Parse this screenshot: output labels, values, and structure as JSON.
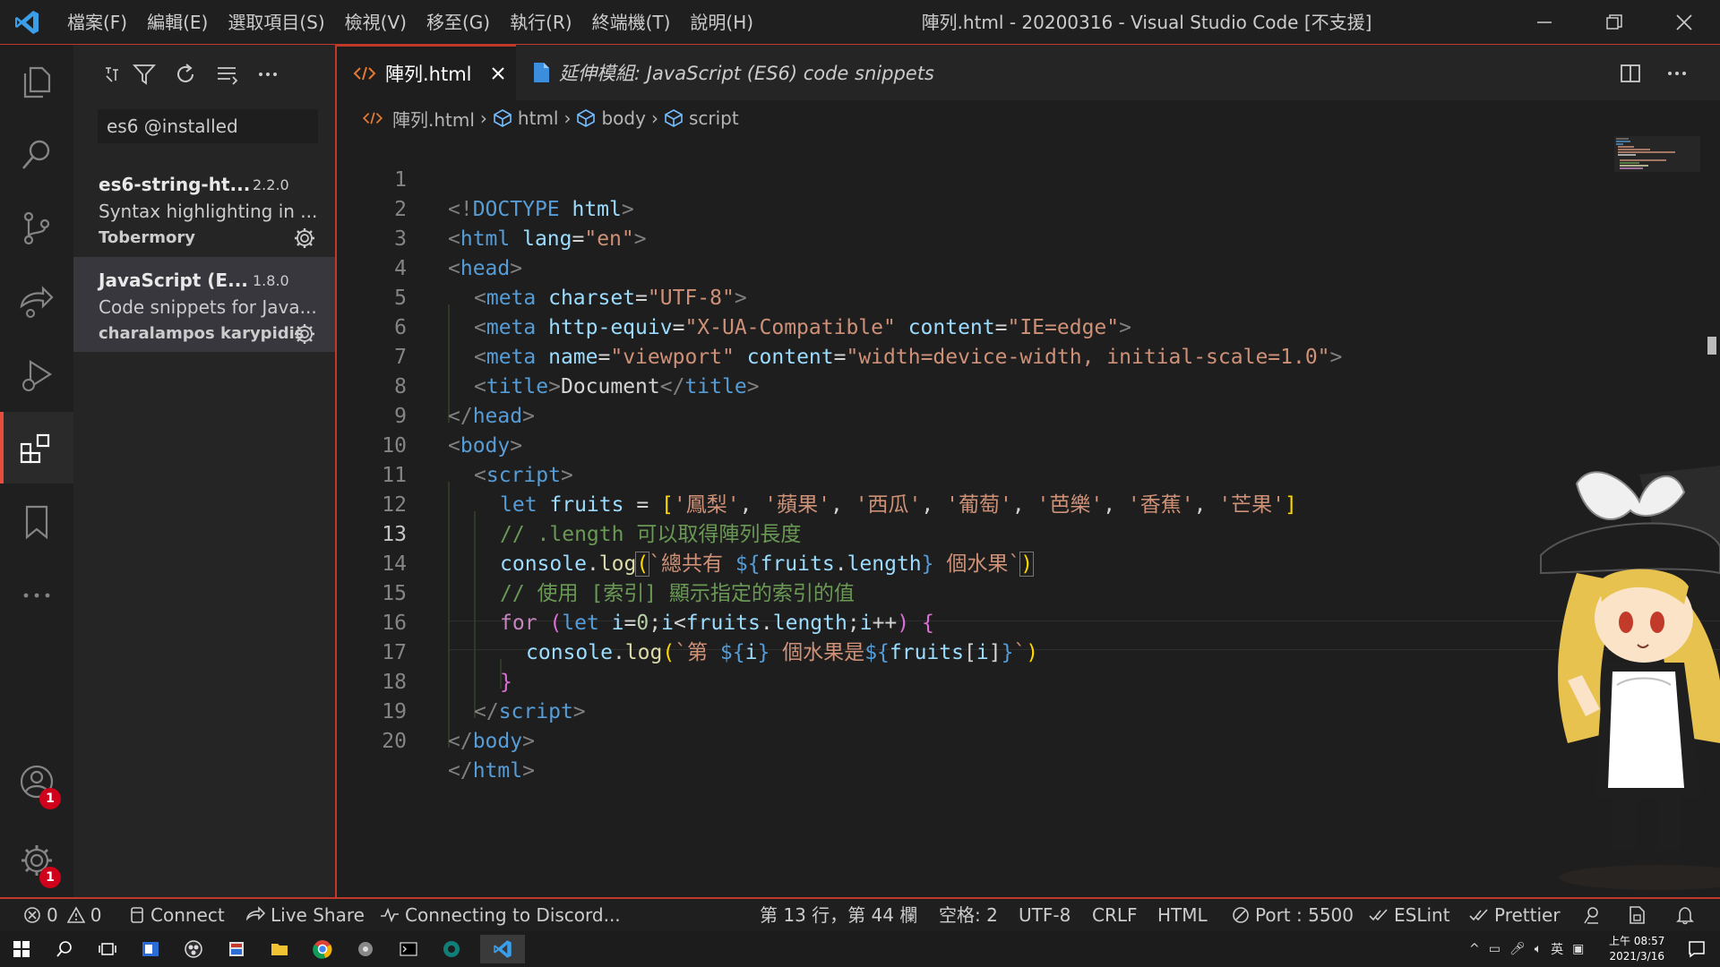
{
  "titlebar": {
    "menu": [
      "檔案(F)",
      "編輯(E)",
      "選取項目(S)",
      "檢視(V)",
      "移至(G)",
      "執行(R)",
      "終端機(T)",
      "說明(H)"
    ],
    "window_title": "陣列.html - 20200316 - Visual Studio Code [不支援]"
  },
  "activitybar": {
    "items": [
      "files-icon",
      "search-icon",
      "source-control-icon",
      "live-share-icon",
      "run-debug-icon",
      "extensions-icon",
      "bookmarks-icon",
      "more-icon"
    ],
    "accounts_badge": "1",
    "settings_badge": "1"
  },
  "sidebar": {
    "toolbar_icons": [
      "clear-icon",
      "filter-icon",
      "refresh-icon",
      "collapse-icon",
      "more-icon"
    ],
    "search_value": "es6 @installed",
    "extensions": [
      {
        "name": "es6-string-ht...",
        "version": "2.2.0",
        "description": "Syntax highlighting in ...",
        "author": "Tobermory"
      },
      {
        "name": "JavaScript (E...",
        "version": "1.8.0",
        "description": "Code snippets for Java...",
        "author": "charalampos karypidis"
      }
    ]
  },
  "tabs": [
    {
      "label": "陣列.html",
      "icon": "html-file-icon",
      "active": true
    },
    {
      "label": "延伸模組: JavaScript (ES6) code snippets",
      "icon": "file-icon",
      "active": false
    }
  ],
  "breadcrumb": [
    "陣列.html",
    "html",
    "body",
    "script"
  ],
  "editor": {
    "line_numbers": [
      "1",
      "2",
      "3",
      "4",
      "5",
      "6",
      "7",
      "8",
      "9",
      "10",
      "11",
      "12",
      "13",
      "14",
      "15",
      "16",
      "17",
      "18",
      "19",
      "20"
    ],
    "current_line": "13",
    "lines": {
      "l1": {
        "a": "<!",
        "b": "DOCTYPE",
        "c": " html",
        "d": ">"
      },
      "l2": {
        "a": "<",
        "b": "html",
        "c": " lang",
        "d": "=",
        "e": "\"en\"",
        "f": ">"
      },
      "l3": {
        "a": "<",
        "b": "head",
        "c": ">"
      },
      "l4": {
        "a": "<",
        "b": "meta",
        "c": " charset",
        "d": "=",
        "e": "\"UTF-8\"",
        "f": ">"
      },
      "l5": {
        "a": "<",
        "b": "meta",
        "c": " http-equiv",
        "d": "=",
        "e": "\"X-UA-Compatible\"",
        "f": " content",
        "g": "=",
        "h": "\"IE=edge\"",
        "i": ">"
      },
      "l6": {
        "a": "<",
        "b": "meta",
        "c": " name",
        "d": "=",
        "e": "\"viewport\"",
        "f": " content",
        "g": "=",
        "h": "\"width=device-width, initial-scale=1.0\"",
        "i": ">"
      },
      "l7": {
        "a": "<",
        "b": "title",
        "c": ">",
        "d": "Document",
        "e": "</",
        "f": "title",
        "g": ">"
      },
      "l8": {
        "a": "</",
        "b": "head",
        "c": ">"
      },
      "l9": {
        "a": "<",
        "b": "body",
        "c": ">"
      },
      "l10": {
        "a": "<",
        "b": "script",
        "c": ">"
      },
      "l11": {
        "a": "let",
        "b": " fruits",
        "c": " = ",
        "d": "[",
        "e": "'鳳梨'",
        "f": ", ",
        "g": "'蘋果'",
        "h": ", ",
        "i": "'西瓜'",
        "j": ", ",
        "k": "'葡萄'",
        "l": ", ",
        "m": "'芭樂'",
        "n": ", ",
        "o": "'香蕉'",
        "p": ", ",
        "q": "'芒果'",
        "r": "]"
      },
      "l12": {
        "a": "// .length 可以取得陣列長度"
      },
      "l13": {
        "a": "console",
        "b": ".",
        "c": "log",
        "d": "(",
        "e": "`總共有 ",
        "f": "${",
        "g": "fruits",
        "h": ".",
        "i": "length",
        "j": "}",
        "k": " 個水果`",
        "l": ")"
      },
      "l14": {
        "a": "// 使用 [索引] 顯示指定的索引的值"
      },
      "l15": {
        "a": "for",
        "b": " (",
        "c": "let",
        "d": " i",
        "e": "=",
        "f": "0",
        "g": ";",
        "h": "i",
        "i": "<",
        "j": "fruits",
        "k": ".",
        "l": "length",
        "m": ";",
        "n": "i",
        "o": "++",
        "p": ") ",
        "q": "{"
      },
      "l16": {
        "a": "console",
        "b": ".",
        "c": "log",
        "d": "(",
        "e": "`第 ",
        "f": "${",
        "g": "i",
        "h": "}",
        "i": " 個水果是",
        "j": "${",
        "k": "fruits",
        "l": "[",
        "m": "i",
        "n": "]",
        "o": "}",
        "p": "`",
        "q": ")"
      },
      "l17": {
        "a": "}"
      },
      "l18": {
        "a": "</",
        "b": "script",
        "c": ">"
      },
      "l19": {
        "a": "</",
        "b": "body",
        "c": ">"
      },
      "l20": {
        "a": "</",
        "b": "html",
        "c": ">"
      }
    }
  },
  "statusbar": {
    "errors": "0",
    "warnings": "0",
    "connect": "Connect",
    "live_share": "Live Share",
    "discord": "Connecting to Discord...",
    "position": "第 13 行，第 44 欄",
    "spaces": "空格: 2",
    "encoding": "UTF-8",
    "eol": "CRLF",
    "language": "HTML",
    "port": "Port : 5500",
    "eslint": "ESLint",
    "prettier": "Prettier"
  },
  "taskbar": {
    "tray_ime": "英",
    "clock_time": "上午 08:57",
    "clock_date": "2021/3/16"
  },
  "colors": {
    "accent": "#c0392b",
    "editor_bg": "#1e1e1e",
    "sidebar_bg": "#252526"
  }
}
